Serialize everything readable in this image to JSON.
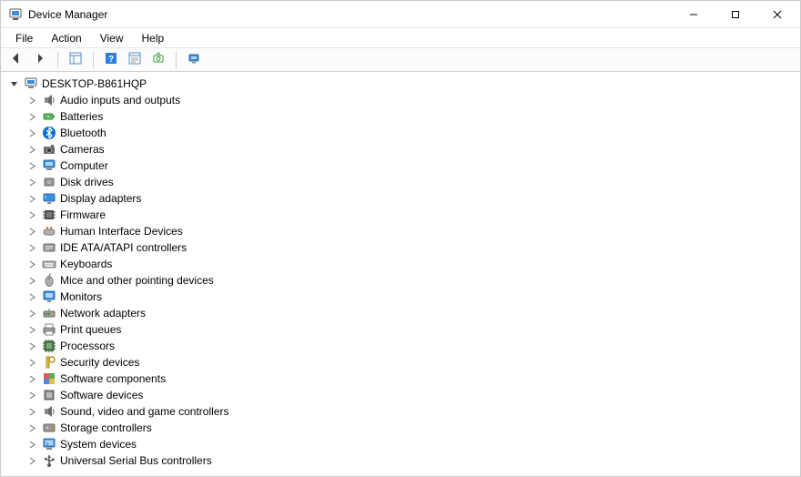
{
  "window": {
    "title": "Device Manager"
  },
  "menubar": {
    "file": "File",
    "action": "Action",
    "view": "View",
    "help": "Help"
  },
  "toolbar": {
    "back": "back-icon",
    "forward": "forward-icon",
    "show_hide": "show-hide-tree-icon",
    "help": "help-icon",
    "properties": "properties-icon",
    "update": "update-driver-icon",
    "scan": "scan-hardware-icon"
  },
  "tree": {
    "root": "DESKTOP-B861HQP",
    "nodes": [
      {
        "label": "Audio inputs and outputs",
        "icon": "audio-icon"
      },
      {
        "label": "Batteries",
        "icon": "battery-icon"
      },
      {
        "label": "Bluetooth",
        "icon": "bluetooth-icon"
      },
      {
        "label": "Cameras",
        "icon": "camera-icon"
      },
      {
        "label": "Computer",
        "icon": "computer-icon"
      },
      {
        "label": "Disk drives",
        "icon": "disk-icon"
      },
      {
        "label": "Display adapters",
        "icon": "display-adapter-icon"
      },
      {
        "label": "Firmware",
        "icon": "firmware-icon"
      },
      {
        "label": "Human Interface Devices",
        "icon": "hid-icon"
      },
      {
        "label": "IDE ATA/ATAPI controllers",
        "icon": "ide-icon"
      },
      {
        "label": "Keyboards",
        "icon": "keyboard-icon"
      },
      {
        "label": "Mice and other pointing devices",
        "icon": "mouse-icon"
      },
      {
        "label": "Monitors",
        "icon": "monitor-icon"
      },
      {
        "label": "Network adapters",
        "icon": "network-icon"
      },
      {
        "label": "Print queues",
        "icon": "printer-icon"
      },
      {
        "label": "Processors",
        "icon": "processor-icon"
      },
      {
        "label": "Security devices",
        "icon": "security-icon"
      },
      {
        "label": "Software components",
        "icon": "software-components-icon"
      },
      {
        "label": "Software devices",
        "icon": "software-devices-icon"
      },
      {
        "label": "Sound, video and game controllers",
        "icon": "sound-icon"
      },
      {
        "label": "Storage controllers",
        "icon": "storage-icon"
      },
      {
        "label": "System devices",
        "icon": "system-icon"
      },
      {
        "label": "Universal Serial Bus controllers",
        "icon": "usb-icon"
      }
    ]
  }
}
